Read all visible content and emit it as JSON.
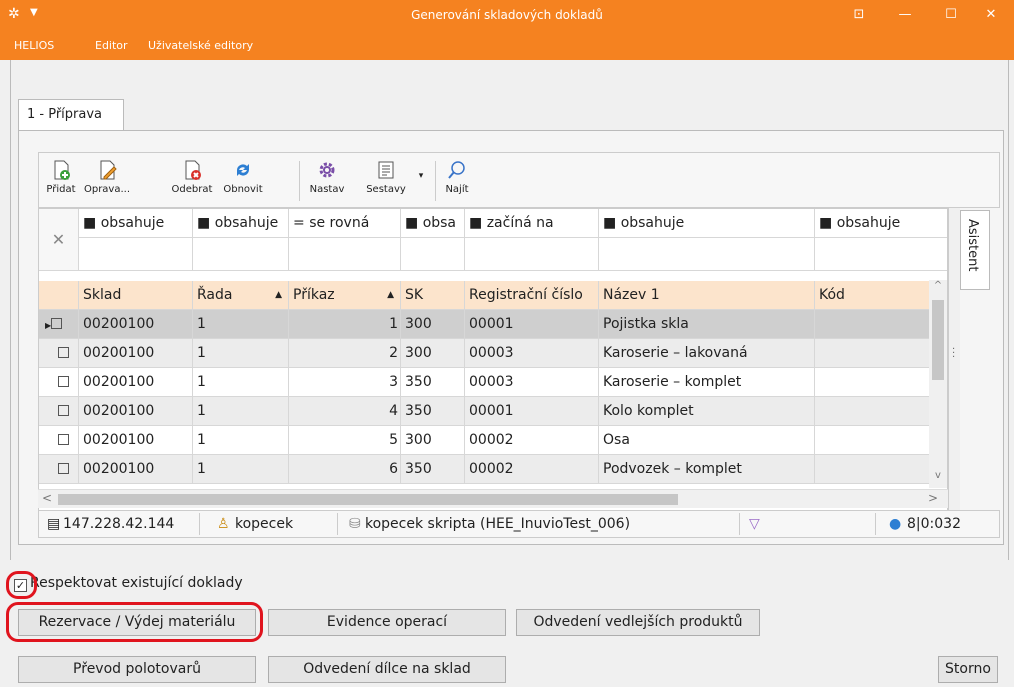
{
  "window": {
    "title": "Generování skladových dokladů",
    "app_icon": "helios-logo-icon",
    "qa_icon": "dropdown-arrow-icon"
  },
  "menu": {
    "items": [
      "HELIOS",
      "Editor",
      "Uživatelské editory"
    ]
  },
  "tab": {
    "label": "1 - Příprava"
  },
  "toolbar": {
    "pridat": "Přidat",
    "oprava": "Oprava...",
    "odebrat": "Odebrat",
    "obnovit": "Obnovit",
    "nastav": "Nastav",
    "sestavy": "Sestavy",
    "najit": "Najít"
  },
  "filters": [
    "obsahuje",
    "obsahuje",
    "se rovná",
    "obsa",
    "začíná na",
    "obsahuje",
    "obsahuje"
  ],
  "filter_symbols": [
    "■",
    "■",
    "=",
    "■",
    "■",
    "■",
    "■"
  ],
  "columns": [
    "Sklad",
    "Řada",
    "Příkaz",
    "SK",
    "Registrační číslo",
    "Název 1",
    "Kód"
  ],
  "rows": [
    [
      "00200100",
      "1",
      "1",
      "300",
      "00001",
      "Pojistka skla",
      ""
    ],
    [
      "00200100",
      "1",
      "2",
      "300",
      "00003",
      "Karoserie – lakovaná",
      ""
    ],
    [
      "00200100",
      "1",
      "3",
      "350",
      "00003",
      "Karoserie – komplet",
      ""
    ],
    [
      "00200100",
      "1",
      "4",
      "350",
      "00001",
      "Kolo komplet",
      ""
    ],
    [
      "00200100",
      "1",
      "5",
      "300",
      "00002",
      "Osa",
      ""
    ],
    [
      "00200100",
      "1",
      "6",
      "350",
      "00002",
      "Podvozek – komplet",
      ""
    ]
  ],
  "side_tab": {
    "label": "Asistent"
  },
  "status": {
    "ip": "147.228.42.144",
    "user": "kopecek",
    "db": "kopecek skripta (HEE_InuvioTest_006)",
    "count": "8|0:032"
  },
  "checkbox": {
    "label": "Respektovat existující doklady",
    "checked": true
  },
  "buttons": {
    "rezervace": "Rezervace / Výdej materiálu",
    "evidence": "Evidence operací",
    "odvedeni_vedl": "Odvedení vedlejších produktů",
    "prevod": "Převod polotovarů",
    "odvedeni_dilce": "Odvedení dílce na sklad",
    "storno": "Storno"
  },
  "colors": {
    "accent": "#f58220",
    "header_row": "#fce4cc",
    "highlight": "#e0141e"
  }
}
